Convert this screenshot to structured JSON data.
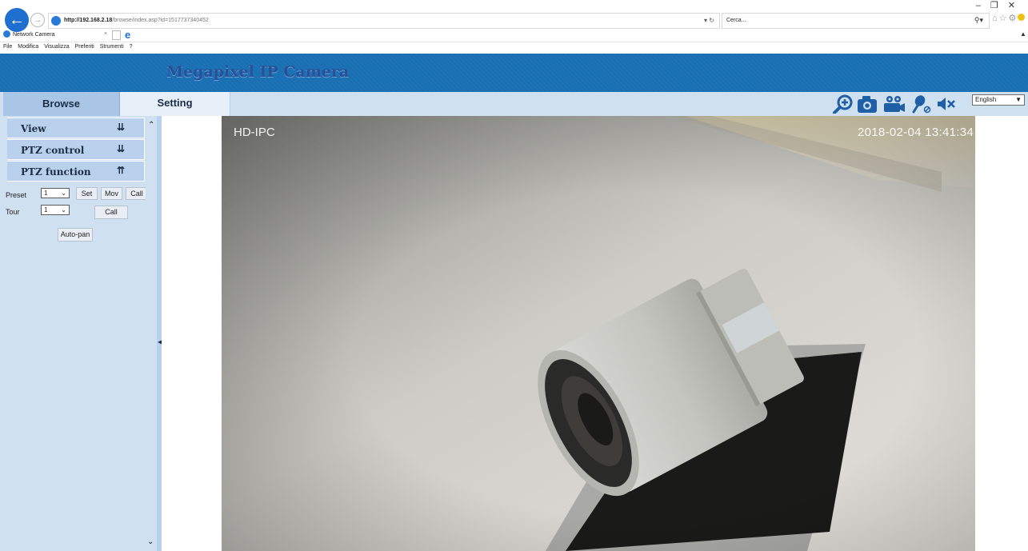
{
  "browser": {
    "url_host": "http://192.168.2.18",
    "url_path": "/browse/index.asp?id=1517737340452",
    "search_placeholder": "Cerca...",
    "tab_title": "Network Camera",
    "menu": [
      "File",
      "Modifica",
      "Visualizza",
      "Preferiti",
      "Strumenti",
      "?"
    ]
  },
  "app": {
    "title": "Megapixel IP Camera",
    "tabs": {
      "browse": "Browse",
      "setting": "Setting"
    },
    "language": "English"
  },
  "sidebar": {
    "sections": [
      {
        "label": "View",
        "state": "collapsed"
      },
      {
        "label": "PTZ control",
        "state": "collapsed"
      },
      {
        "label": "PTZ function",
        "state": "expanded"
      }
    ],
    "preset": {
      "label": "Preset",
      "value": "1",
      "buttons": [
        "Set",
        "Mov",
        "Call"
      ]
    },
    "tour": {
      "label": "Tour",
      "value": "1",
      "button": "Call"
    },
    "autopan_label": "Auto-pan"
  },
  "video": {
    "osd_name": "HD-IPC",
    "osd_time": "2018-02-04  13:41:34"
  },
  "colors": {
    "banner": "#1c73b6",
    "panel": "#cfe0f1",
    "icon_blue": "#1f5fa6"
  }
}
